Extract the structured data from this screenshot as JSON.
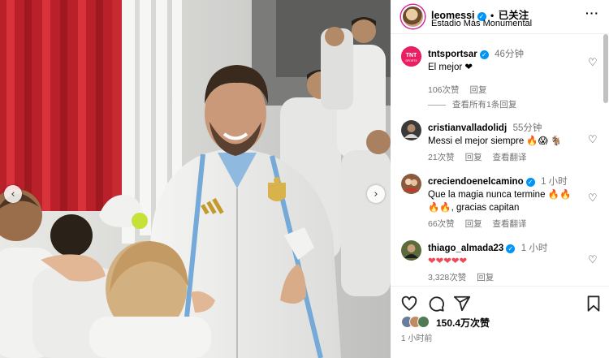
{
  "post": {
    "username": "leomessi",
    "follow_label": "已关注",
    "location": "Estadio Más Monumental",
    "more_label": "···"
  },
  "comments": [
    {
      "user": "tntsportsar",
      "verified": true,
      "time": "46分钟",
      "text": "El mejor ❤",
      "likes": "106次赞",
      "reply_label": "回复",
      "view_replies": "查看所有1条回复",
      "avatar_color": "#e91e63"
    },
    {
      "user": "cristianvalladolidj",
      "verified": false,
      "time": "55分钟",
      "text": "Messi el mejor siempre 🔥😱 🐐",
      "likes": "21次赞",
      "reply_label": "回复",
      "translate_label": "查看翻译",
      "avatar_color": "#3a3a3a"
    },
    {
      "user": "creciendoenelcamino",
      "verified": true,
      "time": "1 小时",
      "text": "Que la magia nunca termine 🔥🔥🔥🔥, gracias capitan",
      "likes": "66次赞",
      "reply_label": "回复",
      "translate_label": "查看翻译",
      "avatar_color": "#8a5a3c"
    },
    {
      "user": "thiago_almada23",
      "verified": true,
      "time": "1 小时",
      "text": "❤❤❤❤❤",
      "likes": "3,328次赞",
      "reply_label": "回复",
      "avatar_color": "#5b6b3a"
    }
  ],
  "footer": {
    "likes": "150.4万次赞",
    "time_ago": "1 小时前"
  },
  "icons": {
    "like": "heart-icon",
    "comment": "comment-icon",
    "share": "share-icon",
    "save": "bookmark-icon",
    "prev": "chevron-left-icon",
    "next": "chevron-right-icon"
  },
  "colors": {
    "verified": "#0095f6",
    "secondary_text": "#737373",
    "reply_heart": "#ed4956"
  }
}
